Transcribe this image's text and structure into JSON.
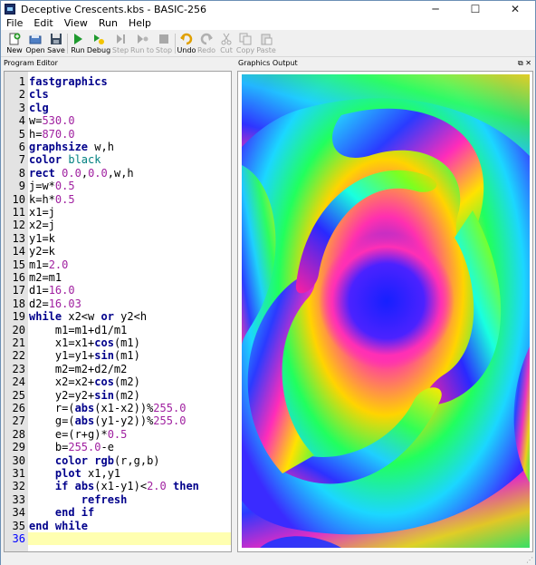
{
  "window": {
    "title": "Deceptive Crescents.kbs - BASIC-256",
    "minimize": "─",
    "maximize": "☐",
    "close": "✕"
  },
  "menu": [
    "File",
    "Edit",
    "View",
    "Run",
    "Help"
  ],
  "toolbar": {
    "new": "New",
    "open": "Open",
    "save": "Save",
    "run": "Run",
    "debug": "Debug",
    "step": "Step",
    "runto": "Run to",
    "stop": "Stop",
    "undo": "Undo",
    "redo": "Redo",
    "cut": "Cut",
    "copy": "Copy",
    "paste": "Paste"
  },
  "panels": {
    "editor_title": "Program Editor",
    "graphics_title": "Graphics Output",
    "dock_icons": "⧉ ✕"
  },
  "code": [
    {
      "n": "1",
      "t": [
        [
          "kw",
          "fastgraphics"
        ]
      ]
    },
    {
      "n": "2",
      "t": [
        [
          "kw",
          "cls"
        ]
      ]
    },
    {
      "n": "3",
      "t": [
        [
          "kw",
          "clg"
        ]
      ]
    },
    {
      "n": "4",
      "t": [
        [
          "op",
          "w="
        ],
        [
          "num",
          "530.0"
        ]
      ]
    },
    {
      "n": "5",
      "t": [
        [
          "op",
          "h="
        ],
        [
          "num",
          "870.0"
        ]
      ]
    },
    {
      "n": "6",
      "t": [
        [
          "kw",
          "graphsize"
        ],
        [
          "op",
          " w,h"
        ]
      ]
    },
    {
      "n": "7",
      "t": [
        [
          "kw",
          "color"
        ],
        [
          "op",
          " "
        ],
        [
          "str",
          "black"
        ]
      ]
    },
    {
      "n": "8",
      "t": [
        [
          "kw",
          "rect"
        ],
        [
          "op",
          " "
        ],
        [
          "num",
          "0.0"
        ],
        [
          "op",
          ","
        ],
        [
          "num",
          "0.0"
        ],
        [
          "op",
          ",w,h"
        ]
      ]
    },
    {
      "n": "9",
      "t": [
        [
          "op",
          "j=w*"
        ],
        [
          "num",
          "0.5"
        ]
      ]
    },
    {
      "n": "10",
      "t": [
        [
          "op",
          "k=h*"
        ],
        [
          "num",
          "0.5"
        ]
      ]
    },
    {
      "n": "11",
      "t": [
        [
          "op",
          "x1=j"
        ]
      ]
    },
    {
      "n": "12",
      "t": [
        [
          "op",
          "x2=j"
        ]
      ]
    },
    {
      "n": "13",
      "t": [
        [
          "op",
          "y1=k"
        ]
      ]
    },
    {
      "n": "14",
      "t": [
        [
          "op",
          "y2=k"
        ]
      ]
    },
    {
      "n": "15",
      "t": [
        [
          "op",
          "m1="
        ],
        [
          "num",
          "2.0"
        ]
      ]
    },
    {
      "n": "16",
      "t": [
        [
          "op",
          "m2=m1"
        ]
      ]
    },
    {
      "n": "17",
      "t": [
        [
          "op",
          "d1="
        ],
        [
          "num",
          "16.0"
        ]
      ]
    },
    {
      "n": "18",
      "t": [
        [
          "op",
          "d2="
        ],
        [
          "num",
          "16.03"
        ]
      ]
    },
    {
      "n": "19",
      "t": [
        [
          "kw",
          "while"
        ],
        [
          "op",
          " x2<w "
        ],
        [
          "kw",
          "or"
        ],
        [
          "op",
          " y2<h"
        ]
      ]
    },
    {
      "n": "20",
      "t": [
        [
          "op",
          "    m1=m1+d1/m1"
        ]
      ]
    },
    {
      "n": "21",
      "t": [
        [
          "op",
          "    x1=x1+"
        ],
        [
          "kw",
          "cos"
        ],
        [
          "op",
          "(m1)"
        ]
      ]
    },
    {
      "n": "22",
      "t": [
        [
          "op",
          "    y1=y1+"
        ],
        [
          "kw",
          "sin"
        ],
        [
          "op",
          "(m1)"
        ]
      ]
    },
    {
      "n": "23",
      "t": [
        [
          "op",
          "    m2=m2+d2/m2"
        ]
      ]
    },
    {
      "n": "24",
      "t": [
        [
          "op",
          "    x2=x2+"
        ],
        [
          "kw",
          "cos"
        ],
        [
          "op",
          "(m2)"
        ]
      ]
    },
    {
      "n": "25",
      "t": [
        [
          "op",
          "    y2=y2+"
        ],
        [
          "kw",
          "sin"
        ],
        [
          "op",
          "(m2)"
        ]
      ]
    },
    {
      "n": "26",
      "t": [
        [
          "op",
          "    r=("
        ],
        [
          "kw",
          "abs"
        ],
        [
          "op",
          "(x1-x2))%"
        ],
        [
          "num",
          "255.0"
        ]
      ]
    },
    {
      "n": "27",
      "t": [
        [
          "op",
          "    g=("
        ],
        [
          "kw",
          "abs"
        ],
        [
          "op",
          "(y1-y2))%"
        ],
        [
          "num",
          "255.0"
        ]
      ]
    },
    {
      "n": "28",
      "t": [
        [
          "op",
          "    e=(r+g)*"
        ],
        [
          "num",
          "0.5"
        ]
      ]
    },
    {
      "n": "29",
      "t": [
        [
          "op",
          "    b="
        ],
        [
          "num",
          "255.0"
        ],
        [
          "op",
          "-e"
        ]
      ]
    },
    {
      "n": "30",
      "t": [
        [
          "op",
          "    "
        ],
        [
          "kw",
          "color"
        ],
        [
          "op",
          " "
        ],
        [
          "kw",
          "rgb"
        ],
        [
          "op",
          "(r,g,b)"
        ]
      ]
    },
    {
      "n": "31",
      "t": [
        [
          "op",
          "    "
        ],
        [
          "kw",
          "plot"
        ],
        [
          "op",
          " x1,y1"
        ]
      ]
    },
    {
      "n": "32",
      "t": [
        [
          "op",
          "    "
        ],
        [
          "kw",
          "if"
        ],
        [
          "op",
          " "
        ],
        [
          "kw",
          "abs"
        ],
        [
          "op",
          "(x1-y1)<"
        ],
        [
          "num",
          "2.0"
        ],
        [
          "op",
          " "
        ],
        [
          "kw",
          "then"
        ]
      ]
    },
    {
      "n": "33",
      "t": [
        [
          "op",
          "        "
        ],
        [
          "kw",
          "refresh"
        ]
      ]
    },
    {
      "n": "34",
      "t": [
        [
          "op",
          "    "
        ],
        [
          "kw",
          "end if"
        ]
      ]
    },
    {
      "n": "35",
      "t": [
        [
          "kw",
          "end while"
        ]
      ]
    },
    {
      "n": "36",
      "t": []
    }
  ],
  "current_line": "36",
  "colors": {
    "keyword": "#00008b",
    "number": "#a020a0",
    "string": "#008080",
    "current_line_bg": "#ffffb0"
  }
}
